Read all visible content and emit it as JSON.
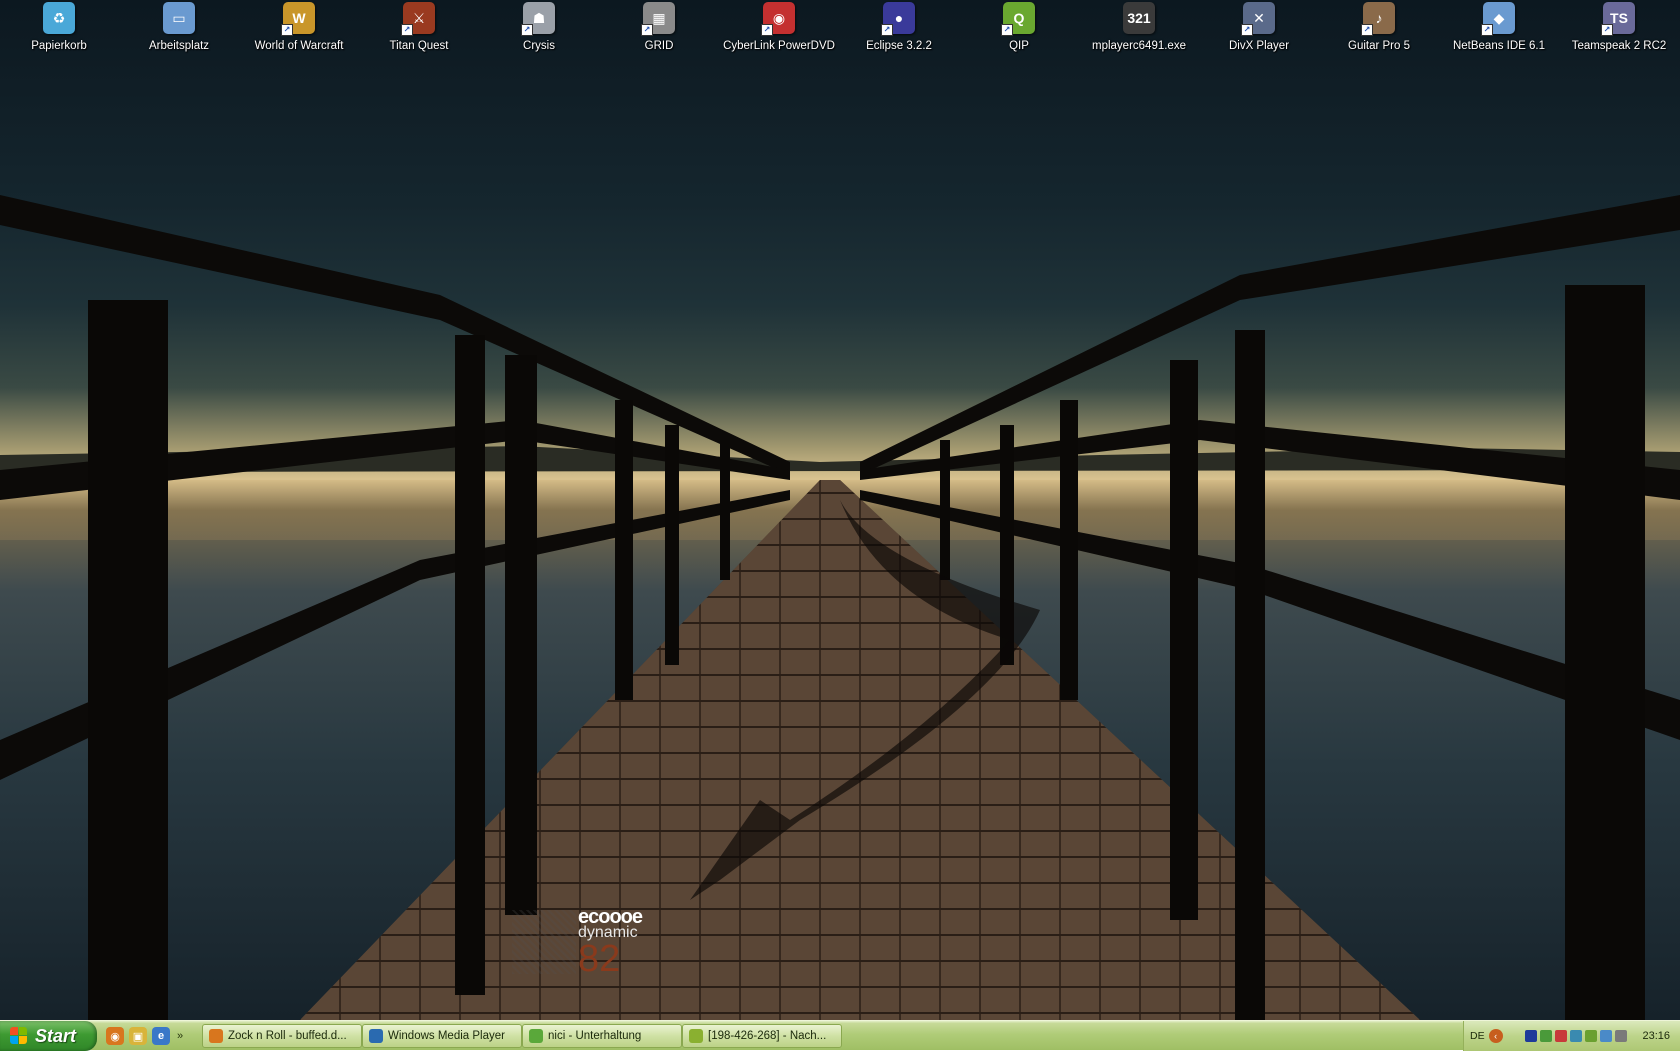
{
  "desktop": {
    "icons": [
      {
        "label": "Papierkorb",
        "glyph": "♻",
        "color": "#4aa8d8",
        "icon": "recycle-bin-icon",
        "shortcut": false
      },
      {
        "label": "Arbeitsplatz",
        "glyph": "▭",
        "color": "#6a9ad0",
        "icon": "computer-icon",
        "shortcut": false
      },
      {
        "label": "World of Warcraft",
        "glyph": "W",
        "color": "#c9962a",
        "icon": "wow-icon",
        "shortcut": true
      },
      {
        "label": "Titan Quest",
        "glyph": "⚔",
        "color": "#9a3a20",
        "icon": "titan-quest-icon",
        "shortcut": true
      },
      {
        "label": "Crysis",
        "glyph": "☗",
        "color": "#9aa0a8",
        "icon": "crysis-icon",
        "shortcut": true
      },
      {
        "label": "GRID",
        "glyph": "▦",
        "color": "#8a8a8a",
        "icon": "grid-icon",
        "shortcut": true
      },
      {
        "label": "CyberLink PowerDVD",
        "glyph": "◉",
        "color": "#c43030",
        "icon": "dvd-icon",
        "shortcut": true
      },
      {
        "label": "Eclipse 3.2.2",
        "glyph": "●",
        "color": "#3a3a9a",
        "icon": "eclipse-icon",
        "shortcut": true
      },
      {
        "label": "QIP",
        "glyph": "Q",
        "color": "#6aa830",
        "icon": "qip-icon",
        "shortcut": true
      },
      {
        "label": "mplayerc6491.exe",
        "glyph": "321",
        "color": "#3a3a3a",
        "icon": "media-player-classic-icon",
        "shortcut": false
      },
      {
        "label": "DivX Player",
        "glyph": "✕",
        "color": "#5a6a8a",
        "icon": "divx-icon",
        "shortcut": true
      },
      {
        "label": "Guitar Pro 5",
        "glyph": "♪",
        "color": "#8a6a4a",
        "icon": "guitar-pro-icon",
        "shortcut": true
      },
      {
        "label": "NetBeans IDE 6.1",
        "glyph": "◆",
        "color": "#6a9ad0",
        "icon": "netbeans-icon",
        "shortcut": true
      },
      {
        "label": "Teamspeak 2 RC2",
        "glyph": "TS",
        "color": "#6a6a9a",
        "icon": "teamspeak-icon",
        "shortcut": true
      }
    ]
  },
  "logo": {
    "line1": "ecoooe",
    "line2": "dynamic",
    "line3": "82"
  },
  "taskbar": {
    "start_label": "Start",
    "quicklaunch": [
      {
        "glyph": "◉",
        "color": "#d8761e",
        "icon": "firefox-icon"
      },
      {
        "glyph": "▣",
        "color": "#d8b43a",
        "icon": "folder-icon"
      },
      {
        "glyph": "e",
        "color": "#3a78c8",
        "icon": "internet-explorer-icon"
      }
    ],
    "chevron": "»",
    "tasks": [
      {
        "label": "Zock n Roll - buffed.d...",
        "color": "#d8761e",
        "icon": "firefox-icon"
      },
      {
        "label": "Windows Media Player",
        "color": "#2a6ab0",
        "icon": "media-player-icon"
      },
      {
        "label": "nici - Unterhaltung",
        "color": "#5aa83a",
        "icon": "messenger-icon"
      },
      {
        "label": "[198-426-268] - Nach...",
        "color": "#8ab030",
        "icon": "chat-window-icon"
      }
    ],
    "tray": {
      "language": "DE",
      "arrow": "‹",
      "icons": [
        {
          "color": "#1e3a9a",
          "icon": "bluetooth-icon"
        },
        {
          "color": "#4a9a3a",
          "icon": "network-icon"
        },
        {
          "color": "#c83a3a",
          "icon": "antivirus-icon"
        },
        {
          "color": "#3a8ab0",
          "icon": "messenger-tray-icon"
        },
        {
          "color": "#6aa030",
          "icon": "qip-tray-icon"
        },
        {
          "color": "#4a8ac8",
          "icon": "network-activity-icon"
        },
        {
          "color": "#7a7a7a",
          "icon": "volume-icon"
        }
      ],
      "clock": "23:16"
    }
  }
}
